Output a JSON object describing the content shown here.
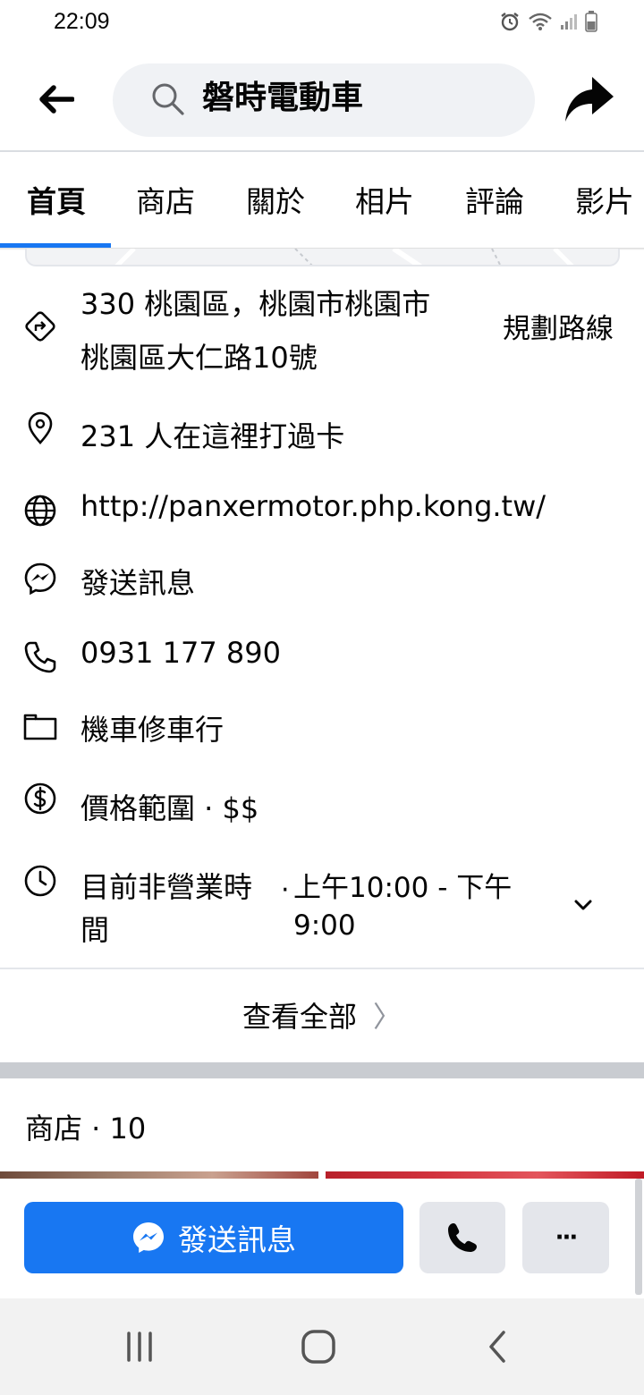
{
  "status_bar": {
    "time": "22:09"
  },
  "search": {
    "query": "磐時電動車"
  },
  "tabs": [
    {
      "label": "首頁",
      "active": true
    },
    {
      "label": "商店",
      "active": false
    },
    {
      "label": "關於",
      "active": false
    },
    {
      "label": "相片",
      "active": false
    },
    {
      "label": "評論",
      "active": false
    },
    {
      "label": "影片",
      "active": false
    }
  ],
  "info": {
    "address_line1": "330 桃園區，桃園市桃園市",
    "address_line2": "桃園區大仁路10號",
    "directions_label": "規劃路線",
    "checkins": "231 人在這裡打過卡",
    "website": "http://panxermotor.php.kong.tw/",
    "message": "發送訊息",
    "phone": "0931 177 890",
    "category": "機車修車行",
    "price_range": "價格範圍 · $$",
    "hours_status_line1": "目前非營業時",
    "hours_status_line2": "間",
    "hours_dot": "·",
    "hours_value_line1": "上午10:00 - 下午",
    "hours_value_line2": "9:00"
  },
  "see_all": {
    "label": "查看全部",
    "chevron": "〉"
  },
  "shop_section": {
    "title": "商店 · 10"
  },
  "action_bar": {
    "message_label": "發送訊息",
    "more_label": "···"
  },
  "colors": {
    "accent": "#1877f2",
    "button_gray": "#e4e6eb",
    "search_bg": "#f0f2f5"
  }
}
